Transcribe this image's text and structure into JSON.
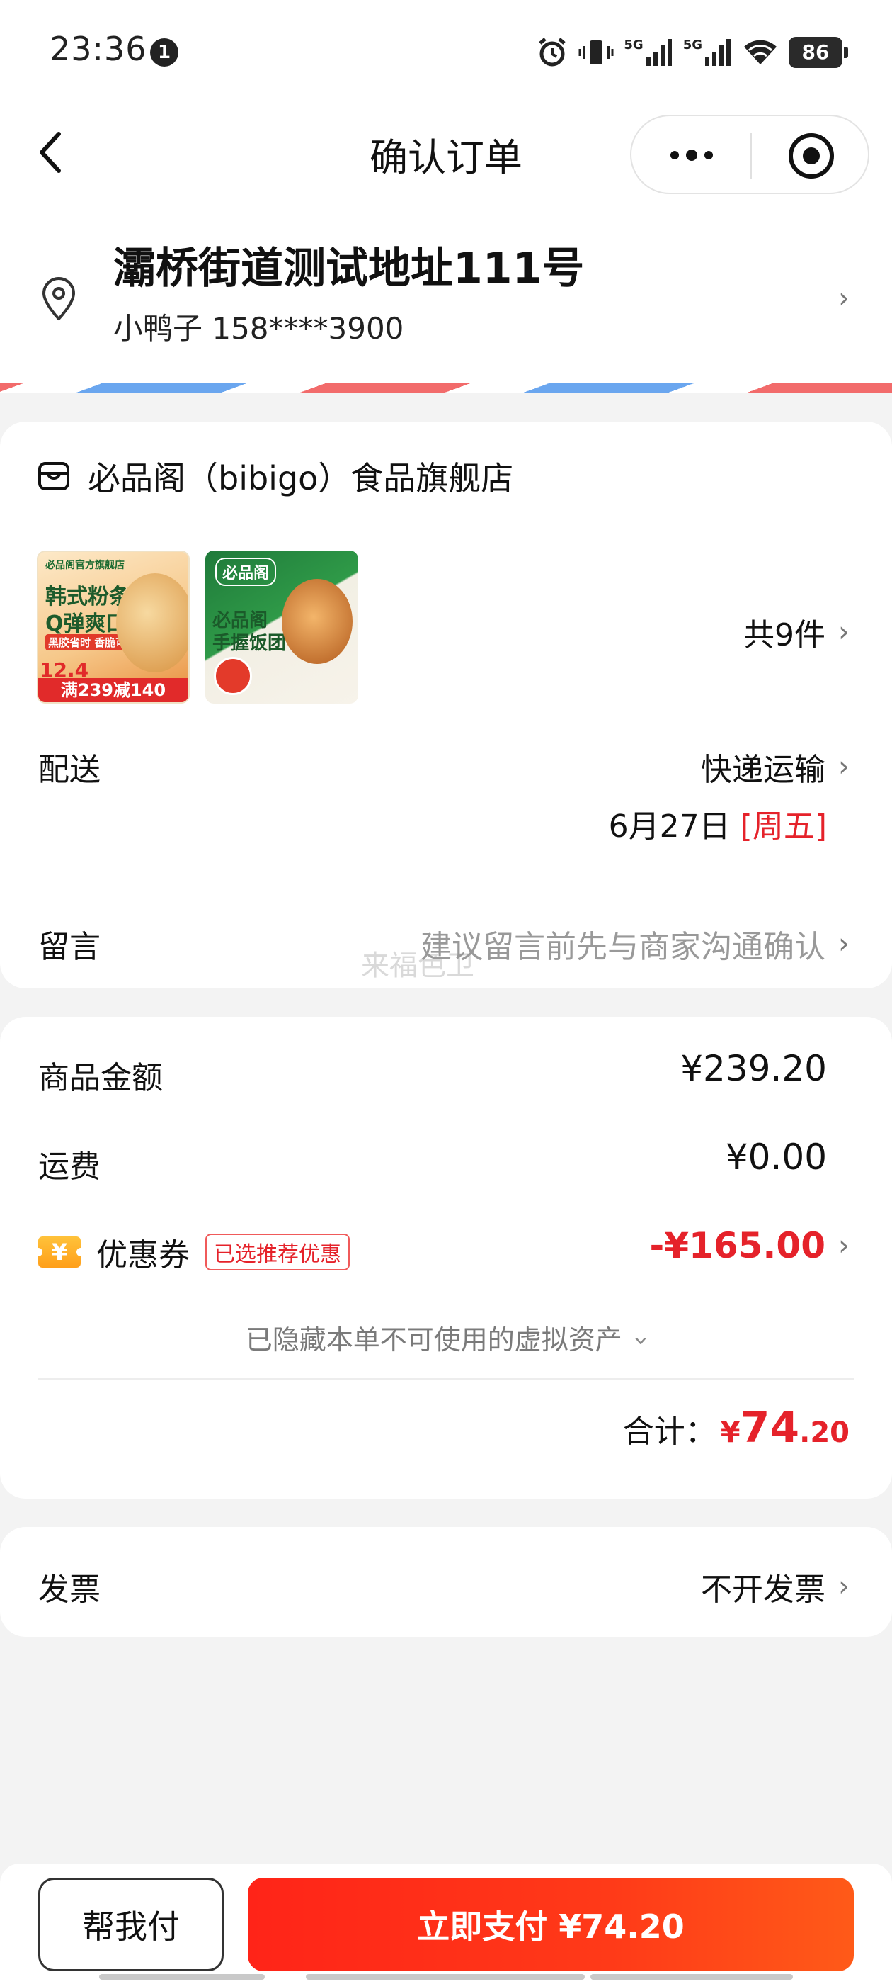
{
  "status_bar": {
    "time": "23:36",
    "notification_count": "1",
    "network_1": "5G",
    "network_2": "5G",
    "battery": "86"
  },
  "nav": {
    "title": "确认订单"
  },
  "address": {
    "line": "灞桥街道测试地址111号",
    "contact": "小鸭子 158****3900"
  },
  "store": {
    "name": "必品阁（bibigo）食品旗舰店",
    "item_count": "共9件",
    "products": [
      {
        "badge": "必品阁官方旗舰店",
        "headline_1": "韩式粉条",
        "headline_2": "Q弹爽口",
        "tagline": "黑胶省时 香脆可口",
        "promo_price": "12.4",
        "promo_banner": "满239减140"
      },
      {
        "brand": "必品阁",
        "headline_1": "必品阁",
        "headline_2": "手握饭团"
      }
    ]
  },
  "delivery": {
    "label": "配送",
    "method": "快递运输",
    "date": "6月27日",
    "weekday": "[周五]"
  },
  "message": {
    "label": "留言",
    "placeholder": "建议留言前先与商家沟通确认",
    "watermark": "来福色卫"
  },
  "amounts": {
    "goods_label": "商品金额",
    "goods_value": "¥239.20",
    "shipping_label": "运费",
    "shipping_value": "¥0.00",
    "coupon_label": "优惠券",
    "coupon_icon_text": "¥",
    "coupon_tag": "已选推荐优惠",
    "coupon_value": "-¥165.00",
    "hidden_assets": "已隐藏本单不可使用的虚拟资产",
    "total_label": "合计：",
    "total_currency": "¥",
    "total_int": "74",
    "total_dec": ".20"
  },
  "invoice": {
    "label": "发票",
    "value": "不开发票"
  },
  "footer": {
    "help_pay": "帮我付",
    "pay_now": "立即支付 ¥74.20"
  },
  "icons": {
    "back": "back-arrow-icon",
    "more": "more-dots-icon",
    "close": "mini-program-close-icon",
    "location": "location-pin-icon",
    "store": "store-icon",
    "chevron": "chevron-right-icon",
    "coupon": "coupon-yuan-icon"
  },
  "colors": {
    "accent_red": "#e5222a",
    "pay_button": "#ff3018",
    "coupon_yellow": "#ffb224",
    "stripe_red": "#f26b6b",
    "stripe_blue": "#6aa6ef"
  }
}
